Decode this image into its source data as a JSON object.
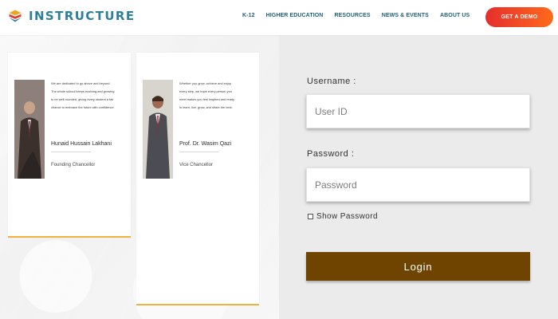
{
  "header": {
    "brand_name": "INSTRUCTURE",
    "nav": [
      {
        "label": "K-12"
      },
      {
        "label": "HIGHER EDUCATION"
      },
      {
        "label": "RESOURCES"
      },
      {
        "label": "NEWS & EVENTS"
      },
      {
        "label": "ABOUT US"
      }
    ],
    "cta": "GET A DEMO"
  },
  "cards": [
    {
      "quote": "We are dedicated to go above and beyond.\nThe whole school keeps evolving and growing\nto be well-rounded, giving every student a fair\nchance to embrace the future with confidence.",
      "name": "Hunaid Hussain Lakhani",
      "title": "Founding Chancellor"
    },
    {
      "quote": "Whether you grow, achieve and enjoy\nevery step, we hope every person you\nmeet makes you feel inspired and ready\nto learn, live, grow, and share the best.",
      "name": "Prof. Dr. Wasim Qazi",
      "title": "Vice Chancellor"
    }
  ],
  "login": {
    "username_label": "Username :",
    "username_placeholder": "User ID",
    "password_label": "Password :",
    "password_placeholder": "Password",
    "show_password_label": "Show Password",
    "login_label": "Login"
  },
  "colors": {
    "brand_teal": "#2f7f98",
    "nav_blue": "#1e5f78",
    "cta_start": "#e52e2e",
    "cta_end": "#ff6a1b",
    "card_accent": "#f1b43a",
    "login_brown": "#6f4300"
  }
}
